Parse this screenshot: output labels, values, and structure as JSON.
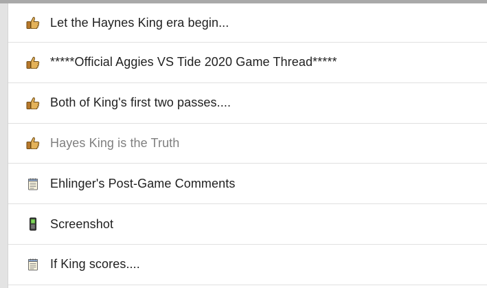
{
  "threads": [
    {
      "title": "Let the Haynes King era begin...",
      "icon": "thumbs-up-icon",
      "visited": false
    },
    {
      "title": "*****Official Aggies VS Tide 2020 Game Thread*****",
      "icon": "thumbs-up-icon",
      "visited": false
    },
    {
      "title": "Both of King's first two passes....",
      "icon": "thumbs-up-icon",
      "visited": false
    },
    {
      "title": "Hayes King is the Truth",
      "icon": "thumbs-up-icon",
      "visited": true
    },
    {
      "title": "Ehlinger's Post-Game Comments",
      "icon": "notepad-icon",
      "visited": false
    },
    {
      "title": "Screenshot",
      "icon": "cellphone-icon",
      "visited": false
    },
    {
      "title": "If King scores....",
      "icon": "notepad-icon",
      "visited": false
    }
  ],
  "colors": {
    "title_text": "#1f1f1f",
    "visited_text": "#7f7f7f",
    "top_bar": "#a9a9a9",
    "side_gutter": "#e3e3e3",
    "row_divider": "#e0e0e0"
  }
}
